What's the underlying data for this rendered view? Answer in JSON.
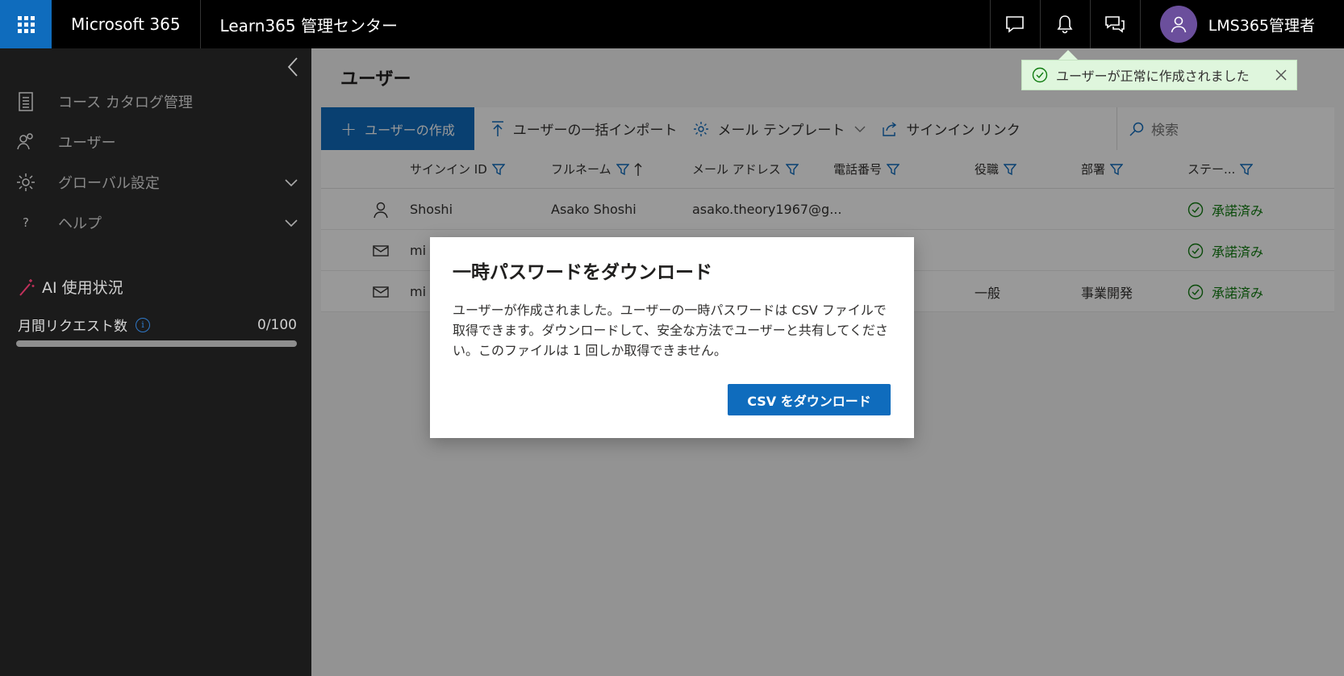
{
  "topbar": {
    "brand": "Microsoft 365",
    "app_name": "Learn365 管理センター",
    "user_name": "LMS365管理者"
  },
  "sidebar": {
    "items": [
      {
        "label": "コース カタログ管理",
        "icon": "catalog-icon"
      },
      {
        "label": "ユーザー",
        "icon": "users-icon"
      },
      {
        "label": "グローバル設定",
        "icon": "gear-icon"
      },
      {
        "label": "ヘルプ",
        "icon": "help-icon"
      }
    ],
    "ai_title": "AI 使用状況",
    "request_label": "月間リクエスト数",
    "request_count": "0/100",
    "request_progress": 0
  },
  "main": {
    "title": "ユーザー",
    "commands": {
      "create": "ユーザーの作成",
      "import": "ユーザーの一括インポート",
      "mail_template": "メール テンプレート",
      "signin_link": "サインイン リンク",
      "search_placeholder": "検索"
    },
    "columns": [
      "サインイン ID",
      "フルネーム",
      "メール アドレス",
      "電話番号",
      "役職",
      "部署",
      "ステー..."
    ],
    "rows": [
      {
        "icon": "person-icon",
        "signin": "Shoshi",
        "fullname": "Asako Shoshi",
        "email": "asako.theory1967@g...",
        "phone": "",
        "title": "",
        "dept": "",
        "status": "承諾済み"
      },
      {
        "icon": "mail-icon",
        "signin": "mi",
        "fullname": "",
        "email": "",
        "phone": "",
        "title": "",
        "dept": "",
        "status": "承諾済み"
      },
      {
        "icon": "mail-icon",
        "signin": "mi",
        "fullname": "",
        "email": "",
        "phone": "",
        "title": "一般",
        "dept": "事業開発",
        "status": "承諾済み"
      }
    ]
  },
  "dialog": {
    "title": "一時パスワードをダウンロード",
    "body": "ユーザーが作成されました。ユーザーの一時パスワードは CSV ファイルで取得できます。ダウンロードして、安全な方法でユーザーと共有してください。このファイルは 1 回しか取得できません。",
    "button": "CSV をダウンロード"
  },
  "toast": {
    "message": "ユーザーが正常に作成されました"
  },
  "colors": {
    "accent": "#0f6cbd",
    "success": "#107c10",
    "avatar": "#6b4f9c"
  }
}
